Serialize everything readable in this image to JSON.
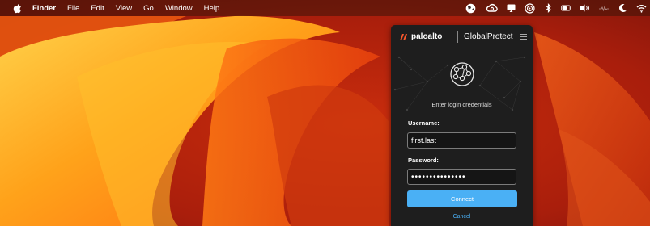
{
  "menubar": {
    "app_name": "Finder",
    "items": [
      "File",
      "Edit",
      "View",
      "Go",
      "Window",
      "Help"
    ],
    "status_icons": [
      "globalprotect-icon",
      "creative-cloud-icon",
      "screen-mirroring-icon",
      "airdrop-icon",
      "bluetooth-icon",
      "battery-icon",
      "volume-icon",
      "network-activity-icon",
      "moon-icon",
      "wifi-icon"
    ]
  },
  "globalprotect": {
    "brand": "paloalto",
    "product": "GlobalProtect",
    "prompt": "Enter login credentials",
    "username_label": "Username:",
    "username_value": "first.last",
    "password_label": "Password:",
    "password_value": "•••••••••••••••",
    "connect_label": "Connect",
    "cancel_label": "Cancel",
    "accent_color": "#4ab0f5",
    "brand_color": "#fa582d"
  }
}
